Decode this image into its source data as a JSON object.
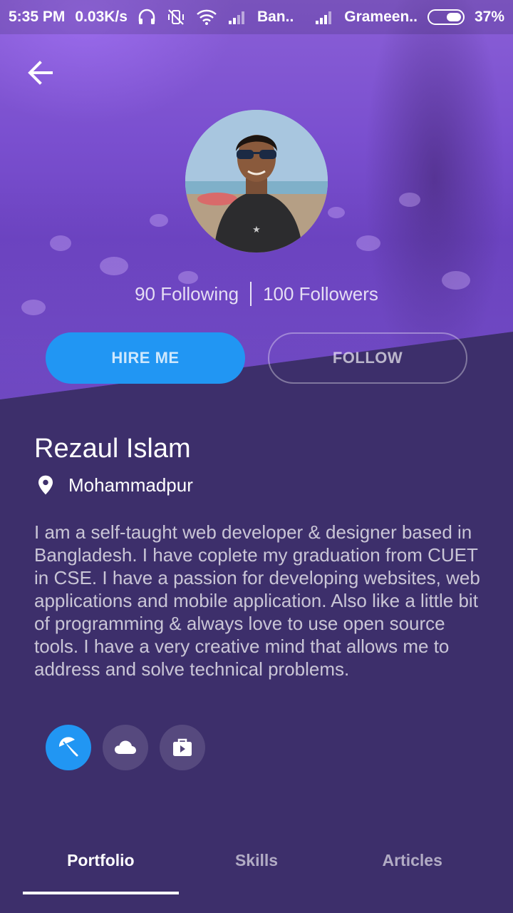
{
  "status_bar": {
    "time": "5:35 PM",
    "speed": "0.03K/s",
    "carrier1": "Ban..",
    "carrier2": "Grameen..",
    "battery": "37%"
  },
  "profile": {
    "following": "90 Following",
    "followers": "100 Followers",
    "hire_label": "HIRE ME",
    "follow_label": "FOLLOW",
    "name": "Rezaul Islam",
    "location": "Mohammadpur",
    "bio": "I am a self-taught web developer & designer based in Bangladesh. I have coplete my graduation from CUET in CSE. I have a passion for developing websites, web applications and mobile application. Also like a little bit of programming & always love to use open source tools. I have a very creative mind that allows me to address and solve technical problems."
  },
  "social": [
    "umbrella-icon",
    "cloud-icon",
    "briefcase-play-icon"
  ],
  "tabs": [
    {
      "label": "Portfolio",
      "active": true
    },
    {
      "label": "Skills",
      "active": false
    },
    {
      "label": "Articles",
      "active": false
    }
  ],
  "colors": {
    "accent": "#2196f3",
    "background": "#3d2f6b",
    "cover": "#7a4fcf"
  }
}
